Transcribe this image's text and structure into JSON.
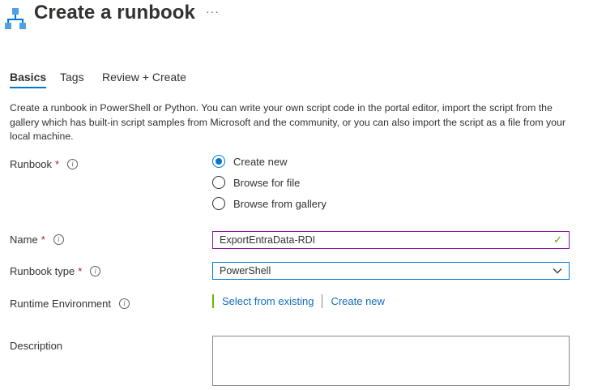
{
  "header": {
    "title": "Create a runbook",
    "more_label": "···",
    "icon": "runbook-hierarchy-icon"
  },
  "tabs": [
    {
      "label": "Basics",
      "active": true
    },
    {
      "label": "Tags",
      "active": false
    },
    {
      "label": "Review + Create",
      "active": false
    }
  ],
  "intro": "Create a runbook in PowerShell or Python. You can write your own script code in the portal editor, import the script from the gallery which has built-in script samples from Microsoft and the community, or you can also import the script as a file from your local machine.",
  "form": {
    "runbook": {
      "label": "Runbook",
      "required_mark": "*",
      "options": [
        {
          "label": "Create new",
          "selected": true
        },
        {
          "label": "Browse for file",
          "selected": false
        },
        {
          "label": "Browse from gallery",
          "selected": false
        }
      ]
    },
    "name": {
      "label": "Name",
      "required_mark": "*",
      "value": "ExportEntraData-RDI",
      "valid_icon": "✓"
    },
    "runbook_type": {
      "label": "Runbook type",
      "required_mark": "*",
      "value": "PowerShell"
    },
    "runtime_environment": {
      "label": "Runtime Environment",
      "select_existing": "Select from existing",
      "create_new": "Create new"
    },
    "description": {
      "label": "Description",
      "value": ""
    }
  },
  "colors": {
    "accent": "#0078d4",
    "link": "#0f6cbd",
    "required": "#a4262c",
    "valid": "#57a300",
    "runtime_bar": "#6bb700"
  }
}
